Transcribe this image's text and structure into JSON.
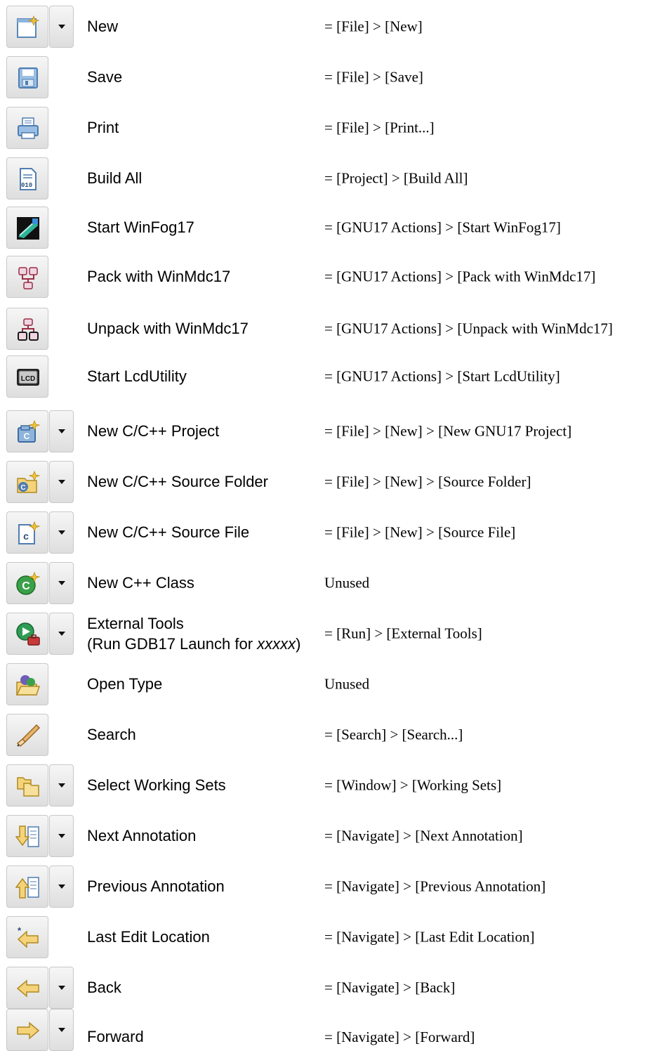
{
  "rows": [
    {
      "name": "New",
      "menu": "= [File] > [New]",
      "icon": "new-wizard-icon"
    },
    {
      "name": "Save",
      "menu": "= [File] > [Save]",
      "icon": "save-icon"
    },
    {
      "name": "Print",
      "menu": "= [File] > [Print...]",
      "icon": "print-icon"
    },
    {
      "name": "Build All",
      "menu": "= [Project] > [Build All]",
      "icon": "build-all-icon"
    },
    {
      "name": "Start WinFog17",
      "menu": "= [GNU17 Actions] > [Start WinFog17]",
      "icon": "winfog-icon"
    },
    {
      "name": "Pack with WinMdc17",
      "menu": "= [GNU17 Actions] > [Pack with WinMdc17]",
      "icon": "pack-icon"
    },
    {
      "name": "Unpack with WinMdc17",
      "menu": "= [GNU17 Actions] > [Unpack with WinMdc17]",
      "icon": "unpack-icon"
    },
    {
      "name": "Start LcdUtility",
      "menu": "= [GNU17 Actions] > [Start LcdUtility]",
      "icon": "lcd-icon",
      "icon_text": "LCD"
    },
    {
      "name": "New C/C++ Project",
      "menu": "= [File] > [New] > [New GNU17 Project]",
      "icon": "new-c-project-icon"
    },
    {
      "name": "New C/C++ Source Folder",
      "menu": "= [File] > [New] > [Source Folder]",
      "icon": "new-source-folder-icon"
    },
    {
      "name": "New C/C++ Source File",
      "menu": "= [File] > [New] > [Source File]",
      "icon": "new-source-file-icon"
    },
    {
      "name": "New C++ Class",
      "menu": "Unused",
      "icon": "new-class-icon"
    },
    {
      "name_line1": "External Tools",
      "name_line2_a": "(Run GDB17 Launch for ",
      "name_line2_italic": "xxxxx",
      "name_line2_b": ")",
      "menu": "= [Run] > [External Tools]",
      "icon": "external-tools-icon"
    },
    {
      "name": "Open Type",
      "menu": "Unused",
      "icon": "open-type-icon"
    },
    {
      "name": "Search",
      "menu": "= [Search] > [Search...]",
      "icon": "search-icon"
    },
    {
      "name": "Select Working Sets",
      "menu": "= [Window] > [Working Sets]",
      "icon": "working-sets-icon"
    },
    {
      "name": "Next Annotation",
      "menu": "= [Navigate] > [Next Annotation]",
      "icon": "next-annotation-icon"
    },
    {
      "name": "Previous Annotation",
      "menu": "= [Navigate] > [Previous Annotation]",
      "icon": "previous-annotation-icon"
    },
    {
      "name": "Last Edit Location",
      "menu": "= [Navigate] > [Last Edit Location]",
      "icon": "last-edit-location-icon"
    },
    {
      "name": "Back",
      "menu": "= [Navigate] > [Back]",
      "icon": "back-icon"
    },
    {
      "name": "Forward",
      "menu": "= [Navigate] > [Forward]",
      "icon": "forward-icon"
    }
  ]
}
